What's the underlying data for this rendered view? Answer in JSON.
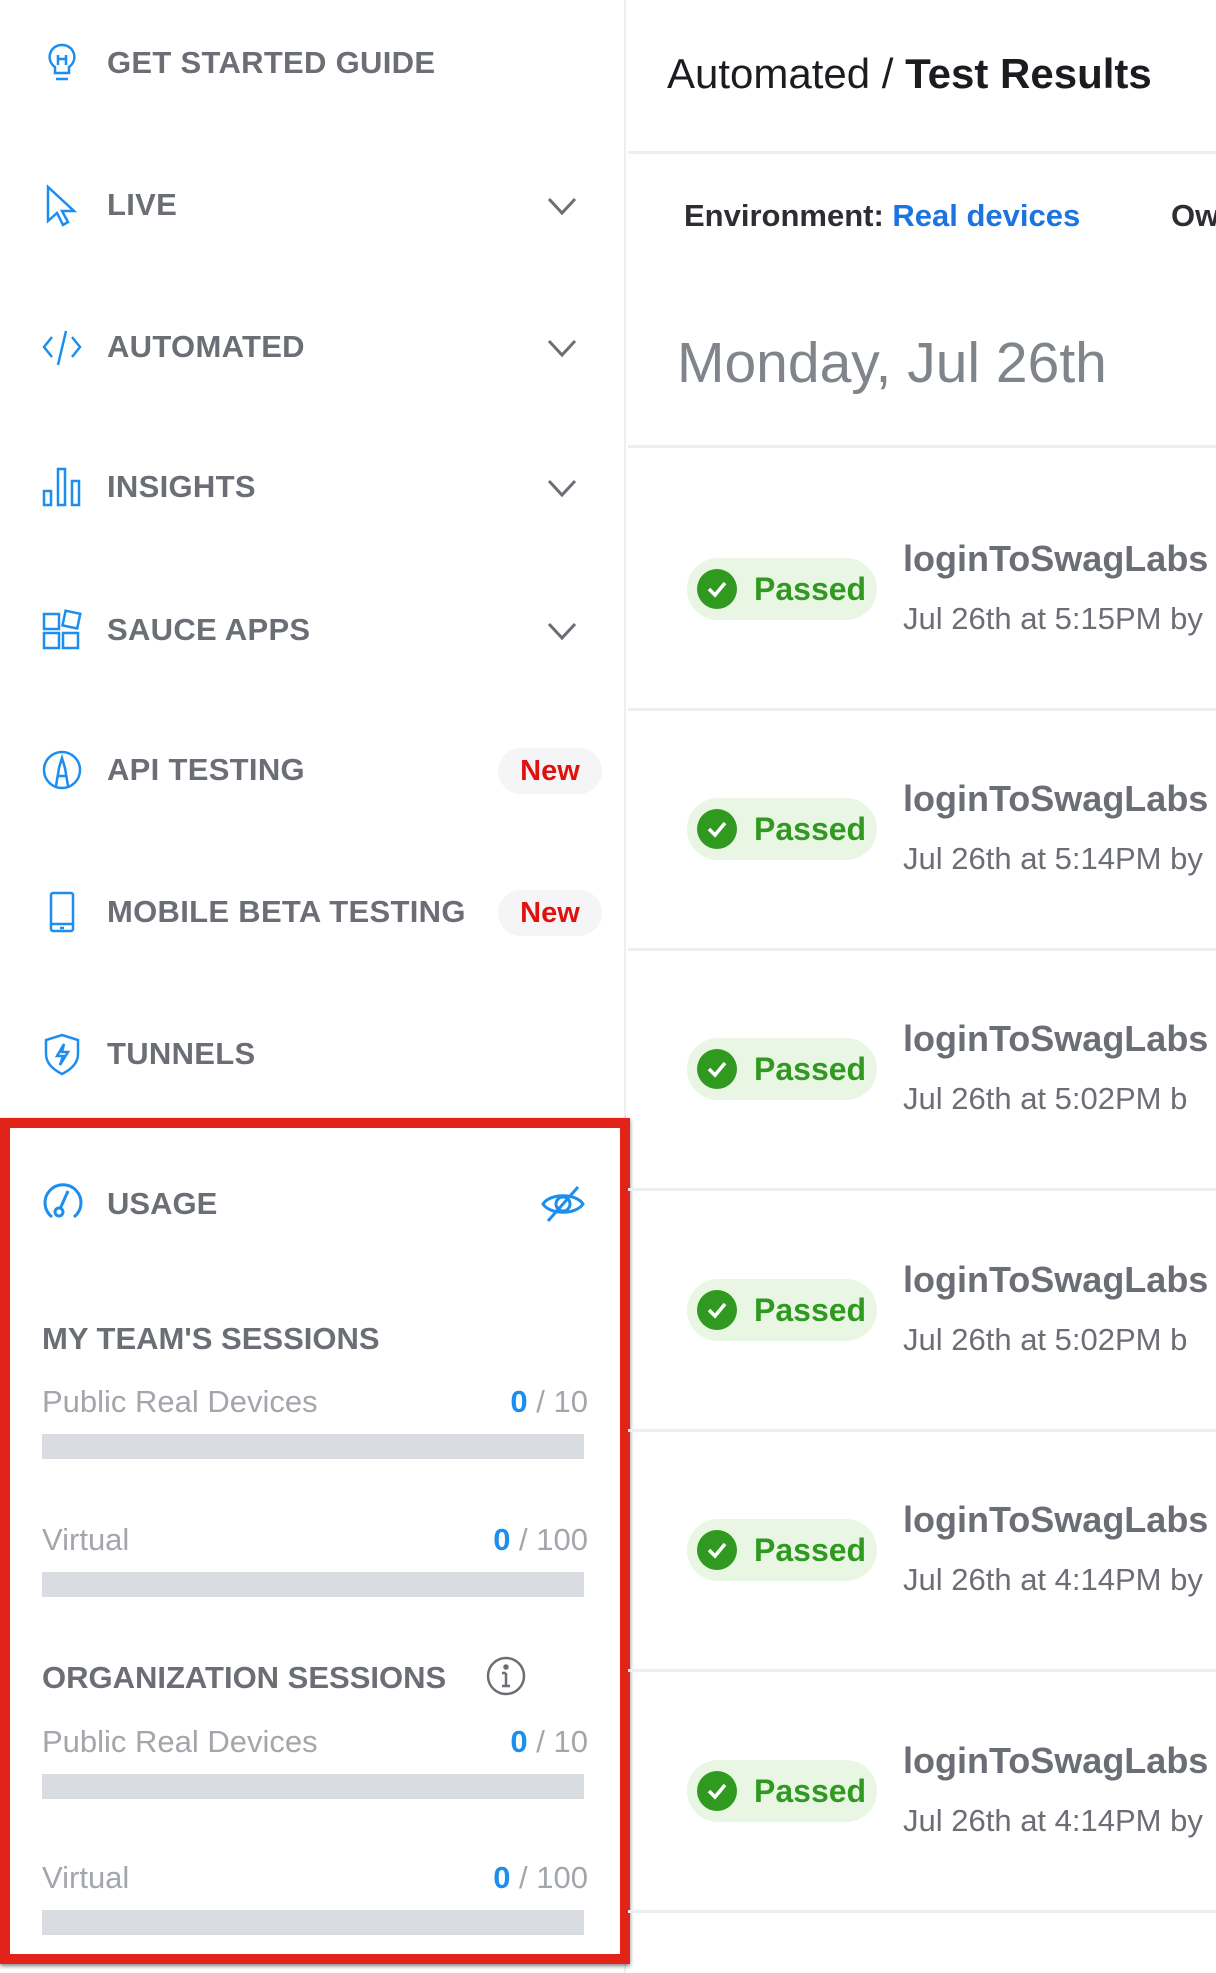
{
  "sidebar": {
    "items": [
      {
        "label": "GET STARTED GUIDE",
        "icon": "lightbulb-icon"
      },
      {
        "label": "LIVE",
        "icon": "cursor-icon",
        "expandable": true
      },
      {
        "label": "AUTOMATED",
        "icon": "code-icon",
        "expandable": true
      },
      {
        "label": "INSIGHTS",
        "icon": "bar-chart-icon",
        "expandable": true
      },
      {
        "label": "SAUCE APPS",
        "icon": "apps-grid-icon",
        "expandable": true
      },
      {
        "label": "API TESTING",
        "icon": "api-icon",
        "badge": "New"
      },
      {
        "label": "MOBILE BETA TESTING",
        "icon": "mobile-icon",
        "badge": "New"
      },
      {
        "label": "TUNNELS",
        "icon": "shield-bolt-icon"
      }
    ],
    "usage": {
      "title": "USAGE",
      "icon": "gauge-icon",
      "toggle_icon": "eye-slash-icon",
      "team": {
        "heading": "MY TEAM'S SESSIONS",
        "rows": [
          {
            "label": "Public Real Devices",
            "used": "0",
            "limit": " / 10",
            "fraction": 0
          },
          {
            "label": "Virtual",
            "used": "0",
            "limit": " / 100",
            "fraction": 0
          }
        ]
      },
      "org": {
        "heading": "ORGANIZATION SESSIONS",
        "info_icon": "info-icon",
        "rows": [
          {
            "label": "Public Real Devices",
            "used": "0",
            "limit": " / 10",
            "fraction": 0
          },
          {
            "label": "Virtual",
            "used": "0",
            "limit": " / 100",
            "fraction": 0
          }
        ]
      }
    }
  },
  "header": {
    "breadcrumb_parent": "Automated / ",
    "title": "Test Results"
  },
  "filters": {
    "environment_label": "Environment: ",
    "environment_value": "Real devices",
    "owner_label": "Ow"
  },
  "date_group": "Monday, Jul 26th",
  "results": [
    {
      "status": "Passed",
      "name": "loginToSwagLabs",
      "meta": "Jul 26th at 5:15PM by"
    },
    {
      "status": "Passed",
      "name": "loginToSwagLabs",
      "meta": "Jul 26th at 5:14PM by"
    },
    {
      "status": "Passed",
      "name": "loginToSwagLabs",
      "meta": "Jul 26th at 5:02PM b"
    },
    {
      "status": "Passed",
      "name": "loginToSwagLabs",
      "meta": "Jul 26th at 5:02PM b"
    },
    {
      "status": "Passed",
      "name": "loginToSwagLabs",
      "meta": "Jul 26th at 4:14PM by"
    },
    {
      "status": "Passed",
      "name": "loginToSwagLabs",
      "meta": "Jul 26th at 4:14PM by"
    }
  ],
  "colors": {
    "accent": "#1c8ef0",
    "passed": "#2f9a1f",
    "highlight_border": "#e2231a",
    "new_badge": "#e0120e"
  }
}
